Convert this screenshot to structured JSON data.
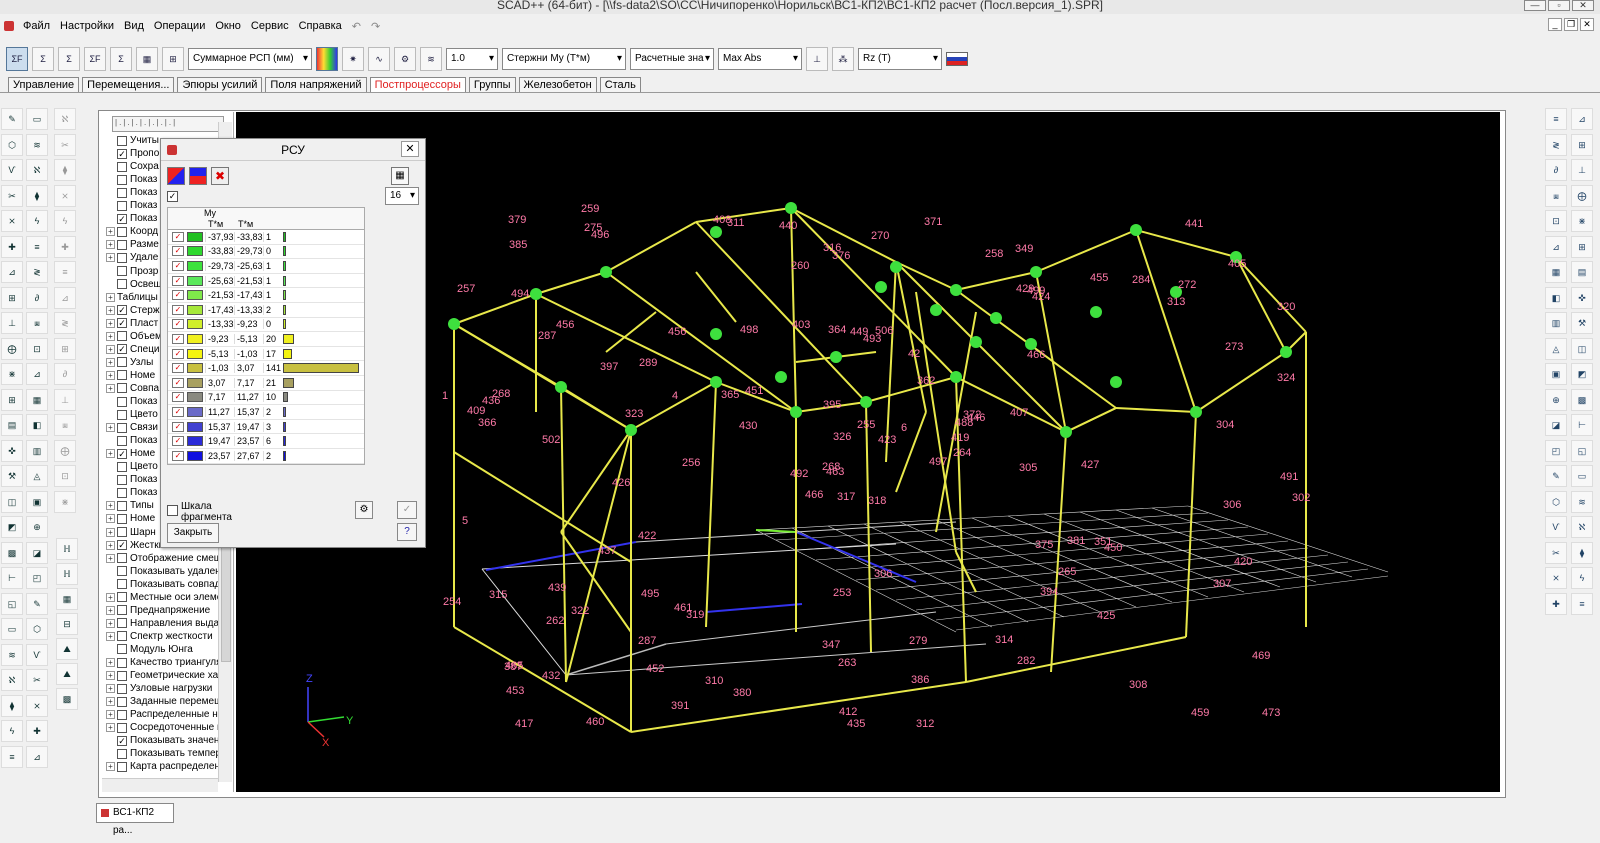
{
  "window": {
    "title": "SCAD++ (64-бит) - [\\\\fs-data2\\SO\\CC\\Ничипоренко\\Норильск\\ВС1-КП2\\ВС1-КП2 расчет (Посл.версия_1).SPR]"
  },
  "menu": [
    "Файл",
    "Настройки",
    "Вид",
    "Операции",
    "Окно",
    "Сервис",
    "Справка"
  ],
  "toolbar": {
    "buttons": [
      {
        "id": "sum",
        "label": "ΣF"
      },
      {
        "id": "sum2",
        "label": "Σ"
      },
      {
        "id": "sum3",
        "label": "Σ"
      },
      {
        "id": "sum4",
        "label": "ΣF"
      },
      {
        "id": "sum5",
        "label": "Σ"
      },
      {
        "id": "sum6",
        "label": "▦"
      },
      {
        "id": "sum7",
        "label": "⊞"
      }
    ],
    "combo_displacement": "Суммарное РСП (мм)",
    "combo_scale": "1.0",
    "combo_bars": "Стержни My (Т*м)",
    "combo_values": "Расчетные зна",
    "combo_mode": "Max Abs",
    "combo_reaction": "Rz (T)"
  },
  "tabs": [
    {
      "label": "Управление",
      "active": false
    },
    {
      "label": "Перемещения...",
      "active": false
    },
    {
      "label": "Эпюры усилий",
      "active": false
    },
    {
      "label": "Поля напряжений",
      "active": false
    },
    {
      "label": "Постпроцессоры",
      "active": true
    },
    {
      "label": "Группы",
      "active": false
    },
    {
      "label": "Железобетон",
      "active": false
    },
    {
      "label": "Сталь",
      "active": false
    }
  ],
  "tree": {
    "items": [
      {
        "label": "Учиты",
        "checked": false,
        "expand": false
      },
      {
        "label": "Пропо",
        "checked": true,
        "expand": false
      },
      {
        "label": "Сохра",
        "checked": false,
        "expand": false
      },
      {
        "label": "Показ",
        "checked": false,
        "expand": false
      },
      {
        "label": "Показ",
        "checked": false,
        "expand": false
      },
      {
        "label": "Показ",
        "checked": false,
        "expand": false
      },
      {
        "label": "Показ",
        "checked": true,
        "expand": false
      },
      {
        "label": "Коорд",
        "checked": false,
        "expand": true
      },
      {
        "label": "Разме",
        "checked": false,
        "expand": true
      },
      {
        "label": "Удале",
        "checked": false,
        "expand": true
      },
      {
        "label": "Прозр",
        "checked": false,
        "expand": false
      },
      {
        "label": "Освещ",
        "checked": false,
        "expand": false
      },
      {
        "label": "Таблицы",
        "checked": null,
        "expand": true
      },
      {
        "label": "Стерж",
        "checked": true,
        "expand": true
      },
      {
        "label": "Пласт",
        "checked": true,
        "expand": true
      },
      {
        "label": "Объем",
        "checked": false,
        "expand": true
      },
      {
        "label": "Специ",
        "checked": true,
        "expand": true
      },
      {
        "label": "Узлы",
        "checked": false,
        "expand": true
      },
      {
        "label": "Номе",
        "checked": false,
        "expand": true
      },
      {
        "label": "Совпа",
        "checked": false,
        "expand": true
      },
      {
        "label": "Показ",
        "checked": false,
        "expand": false
      },
      {
        "label": "Цвето",
        "checked": false,
        "expand": false
      },
      {
        "label": "Связи",
        "checked": false,
        "expand": true
      },
      {
        "label": "Показ",
        "checked": false,
        "expand": false
      },
      {
        "label": "Номе",
        "checked": true,
        "expand": true
      },
      {
        "label": "Цвето",
        "checked": false,
        "expand": false
      },
      {
        "label": "Показ",
        "checked": false,
        "expand": false
      },
      {
        "label": "Показ",
        "checked": false,
        "expand": false
      },
      {
        "label": "Типы",
        "checked": false,
        "expand": true
      },
      {
        "label": "Номе",
        "checked": false,
        "expand": true
      },
      {
        "label": "Шарн",
        "checked": false,
        "expand": true
      },
      {
        "label": "Жесткие вставки",
        "checked": true,
        "expand": true
      },
      {
        "label": "Отображение смещ",
        "checked": false,
        "expand": true
      },
      {
        "label": "Показывать удален",
        "checked": false,
        "expand": false
      },
      {
        "label": "Показывать совпад",
        "checked": false,
        "expand": false
      },
      {
        "label": "Местные оси элеме",
        "checked": false,
        "expand": true
      },
      {
        "label": "Преднапряжение",
        "checked": false,
        "expand": true
      },
      {
        "label": "Направления выда",
        "checked": false,
        "expand": true
      },
      {
        "label": "Спектр жесткости",
        "checked": false,
        "expand": true
      },
      {
        "label": "Модуль Юнга",
        "checked": false,
        "expand": false
      },
      {
        "label": "Качество триангуля",
        "checked": false,
        "expand": true
      },
      {
        "label": "Геометрические хар",
        "checked": false,
        "expand": true
      },
      {
        "label": "Узловые нагрузки",
        "checked": false,
        "expand": true
      },
      {
        "label": "Заданные перемещ",
        "checked": false,
        "expand": true
      },
      {
        "label": "Распределенные на",
        "checked": false,
        "expand": true
      },
      {
        "label": "Сосредоточенные н",
        "checked": false,
        "expand": true
      },
      {
        "label": "Показывать значен",
        "checked": true,
        "expand": false
      },
      {
        "label": "Показывать темпер",
        "checked": false,
        "expand": false
      },
      {
        "label": "Карта распределен",
        "checked": false,
        "expand": true
      }
    ]
  },
  "rsu_dialog": {
    "title": "РСУ",
    "close": "✕",
    "count_value": "16",
    "column_label": "My",
    "unit1": "Т*м",
    "unit2": "Т*м",
    "rows": [
      {
        "from": "-37,93",
        "to": "-33,83",
        "count": "1",
        "color": "#22c022",
        "frac": 0.01
      },
      {
        "from": "-33,83",
        "to": "-29,73",
        "count": "0",
        "color": "#2ed82e",
        "frac": 0.0
      },
      {
        "from": "-29,73",
        "to": "-25,63",
        "count": "1",
        "color": "#3de23d",
        "frac": 0.01
      },
      {
        "from": "-25,63",
        "to": "-21,53",
        "count": "1",
        "color": "#5ae85a",
        "frac": 0.01
      },
      {
        "from": "-21,53",
        "to": "-17,43",
        "count": "1",
        "color": "#7fe84a",
        "frac": 0.01
      },
      {
        "from": "-17,43",
        "to": "-13,33",
        "count": "2",
        "color": "#a6e83a",
        "frac": 0.015
      },
      {
        "from": "-13,33",
        "to": "-9,23",
        "count": "0",
        "color": "#d0ee2a",
        "frac": 0.0
      },
      {
        "from": "-9,23",
        "to": "-5,13",
        "count": "20",
        "color": "#f0f020",
        "frac": 0.14
      },
      {
        "from": "-5,13",
        "to": "-1,03",
        "count": "17",
        "color": "#f4f410",
        "frac": 0.12
      },
      {
        "from": "-1,03",
        "to": "3,07",
        "count": "141",
        "color": "#c8c040",
        "frac": 1.0
      },
      {
        "from": "3,07",
        "to": "7,17",
        "count": "21",
        "color": "#a8a060",
        "frac": 0.15
      },
      {
        "from": "7,17",
        "to": "11,27",
        "count": "10",
        "color": "#8a8a80",
        "frac": 0.07
      },
      {
        "from": "11,27",
        "to": "15,37",
        "count": "2",
        "color": "#6a6ac8",
        "frac": 0.015
      },
      {
        "from": "15,37",
        "to": "19,47",
        "count": "3",
        "color": "#4040d0",
        "frac": 0.02
      },
      {
        "from": "19,47",
        "to": "23,57",
        "count": "6",
        "color": "#2a2ad8",
        "frac": 0.045
      },
      {
        "from": "23,57",
        "to": "27,67",
        "count": "2",
        "color": "#1010e0",
        "frac": 0.015
      }
    ],
    "scale_label_1": "Шкала",
    "scale_label_2": "фрагмента",
    "close_button": "Закрыть"
  },
  "doc_tab": "ВС1-КП2 ра...",
  "axes": {
    "x": "X",
    "y": "Y",
    "z": "Z"
  },
  "model_labels": [
    "318",
    "287",
    "463",
    "465",
    "488",
    "319",
    "349",
    "506",
    "499",
    "497",
    "496",
    "473",
    "502",
    "320",
    "466",
    "466",
    "460",
    "364",
    "362",
    "322",
    "451",
    "453",
    "452",
    "449",
    "446",
    "450",
    "456",
    "376",
    "366",
    "375",
    "324",
    "268",
    "347",
    "326",
    "456",
    "455",
    "461",
    "459",
    "469",
    "351",
    "371",
    "365",
    "323",
    "394",
    "391",
    "1",
    "419",
    "417",
    "263",
    "264",
    "262",
    "273",
    "257",
    "265",
    "282",
    "287",
    "275",
    "379",
    "279",
    "272",
    "270",
    "256",
    "268",
    "289",
    "284",
    "259",
    "258",
    "260",
    "255",
    "254",
    "253",
    "380",
    "381",
    "4",
    "387",
    "385",
    "397",
    "5",
    "395",
    "386",
    "6",
    "432",
    "305",
    "420",
    "412",
    "304",
    "306",
    "308",
    "312",
    "314",
    "316",
    "302",
    "407",
    "425",
    "423",
    "307",
    "436",
    "435",
    "429",
    "424",
    "426",
    "408",
    "491",
    "409",
    "437",
    "495",
    "310",
    "372",
    "313",
    "430",
    "306",
    "494",
    "493",
    "492",
    "311",
    "315",
    "317",
    "405",
    "403",
    "440",
    "439",
    "441",
    "42",
    "498",
    "427",
    "422"
  ]
}
